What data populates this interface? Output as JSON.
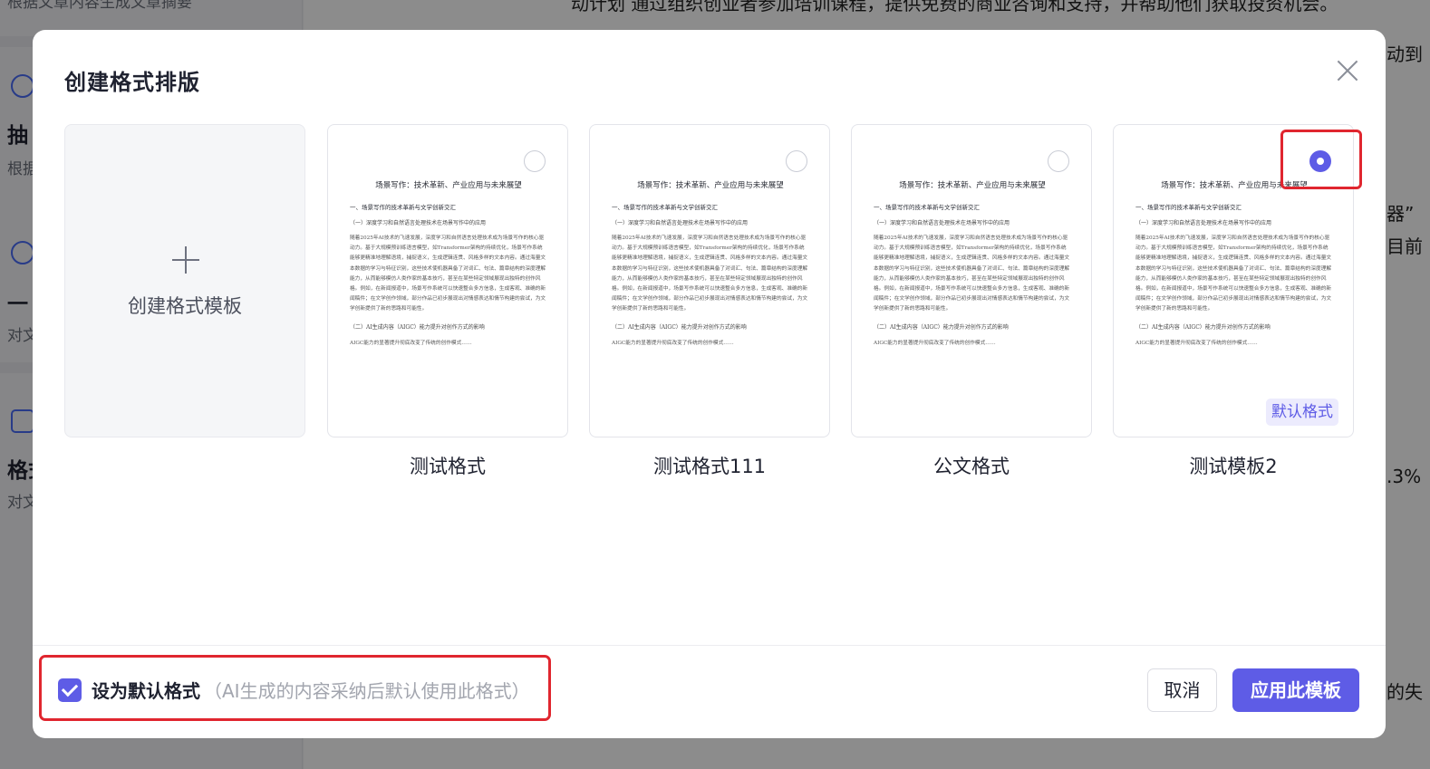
{
  "background": {
    "sidebar": [
      {
        "icon": "ai-icon",
        "title": "抽",
        "desc": "根据"
      },
      {
        "icon": "bulb-icon",
        "title": "一",
        "desc": "对文"
      },
      {
        "icon": "doc-icon",
        "title": "格式",
        "desc": "对文"
      }
    ],
    "sidebar_top_text": "根据文章内容生成文章摘要",
    "main_lines": [
      "动计划 通过组织创业者参加培训课程，提供免费的商业咨询和支持，并帮助他们获取投资机会。",
      "动到",
      "器”",
      "目前",
      ".3%",
      "的失"
    ]
  },
  "modal": {
    "title": "创建格式排版",
    "create_card_label": "创建格式模板",
    "templates": [
      {
        "name": "测试格式",
        "selected": false,
        "is_default": false
      },
      {
        "name": "测试格式111",
        "selected": false,
        "is_default": false
      },
      {
        "name": "公文格式",
        "selected": false,
        "is_default": false
      },
      {
        "name": "测试模板2",
        "selected": true,
        "is_default": true
      }
    ],
    "default_badge": "默认格式",
    "preview": {
      "title": "场景写作：技术革新、产业应用与未来展望",
      "h1": "一、场景写作的技术革新与文学创新交汇",
      "h2a": "（一）深度学习和自然语言处理技术在场景写作中的应用",
      "para": "随着2025年AI技术的飞速发展，深度学习和自然语言处理技术成为场景写作的核心驱动力。基于大规模预训练语言模型，如Transformer架构的持续优化，场景写作系统能够更精准地理解语境，捕捉语义，生成逻辑连贯、风格多样的文本内容。通过海量文本数据的学习与特征识别，这些技术使机器具备了对词汇、句法、篇章结构的深度理解能力，从而能够模仿人类作家的基本技巧，甚至在某些特定领域展现出独特的创作风格。例如，在新闻报道中，场景写作系统可以快速整合多方信息，生成客观、准确的新闻稿件；在文学创作领域，部分作品已初步展现出对情感表达和情节构建的尝试，为文学创新提供了新的思路和可能性。",
      "h2b": "（二）AI生成内容（AIGC）能力提升对创作方式的影响",
      "para2": "AIGC能力的显著提升彻底改变了传统的创作模式……"
    },
    "footer": {
      "checkbox_checked": true,
      "checkbox_label": "设为默认格式",
      "checkbox_hint": "（AI生成的内容采纳后默认使用此格式）",
      "cancel_label": "取消",
      "apply_label": "应用此模板"
    }
  },
  "colors": {
    "accent": "#5e5ce6",
    "highlight": "#e0262f"
  }
}
